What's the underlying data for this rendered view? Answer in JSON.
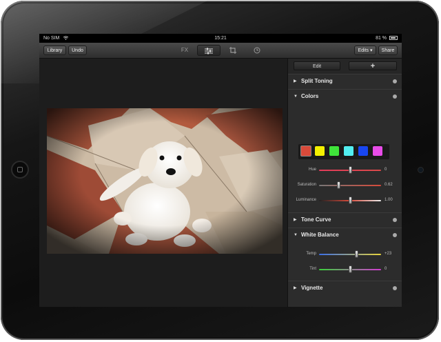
{
  "status_bar": {
    "carrier": "No SIM",
    "time": "15:21",
    "battery": "81 %"
  },
  "toolbar": {
    "library_label": "Library",
    "undo_label": "Undo",
    "tabs": [
      {
        "label": "FX",
        "active": false,
        "icon": "fx-text"
      },
      {
        "label": "",
        "active": true,
        "icon": "sliders-icon"
      },
      {
        "label": "",
        "active": false,
        "icon": "crop-icon"
      },
      {
        "label": "",
        "active": false,
        "icon": "history-clock-icon"
      }
    ],
    "edits_label": "Edits ▾",
    "share_label": "Share"
  },
  "panel": {
    "edit_label": "Edit",
    "add_label": "+",
    "sections": {
      "split_toning": "Split Toning",
      "colors": "Colors",
      "tone_curve": "Tone Curve",
      "white_balance": "White Balance",
      "vignette": "Vignette"
    },
    "color_swatches": [
      "#d84a3a",
      "#f4f000",
      "#3fe43a",
      "#52eef0",
      "#1846f0",
      "#e84ce8"
    ],
    "colors_sliders": [
      {
        "label": "Hue",
        "value": "0",
        "level": 0.5
      },
      {
        "label": "Saturation",
        "value": "0.62",
        "level": 0.32
      },
      {
        "label": "Luminance",
        "value": "1.00",
        "level": 0.5
      }
    ],
    "wb_sliders": [
      {
        "label": "Temp",
        "value": "+23",
        "level": 0.6
      },
      {
        "label": "Tint",
        "value": "0",
        "level": 0.5
      }
    ]
  },
  "colors": {
    "accent_red": "#d84a3a",
    "panel_bg": "#2c2c2c",
    "toolbar_bg": "#3a3a3a"
  }
}
